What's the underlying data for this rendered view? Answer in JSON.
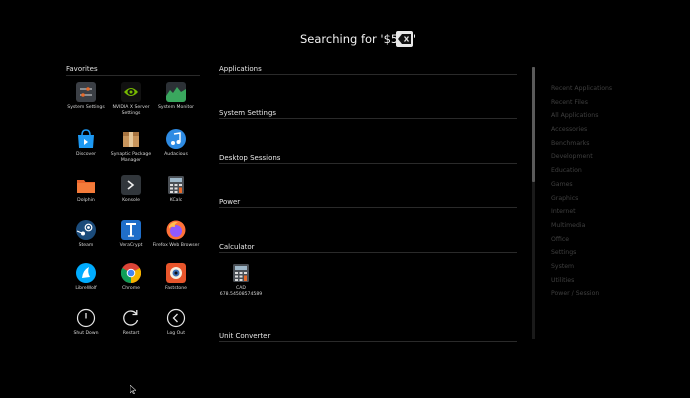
{
  "search": {
    "text": "Searching for '$500'",
    "clear_icon": "backspace-icon"
  },
  "favorites": {
    "header": "Favorites",
    "items": [
      {
        "label": "System Settings",
        "icon": "system-settings-icon"
      },
      {
        "label": "NVIDIA X Server Settings",
        "icon": "nvidia-icon"
      },
      {
        "label": "System Monitor",
        "icon": "system-monitor-icon"
      },
      {
        "label": "Discover",
        "icon": "discover-icon"
      },
      {
        "label": "Synaptic Package Manager",
        "icon": "synaptic-icon"
      },
      {
        "label": "Audacious",
        "icon": "audacious-icon"
      },
      {
        "label": "Dolphin",
        "icon": "dolphin-icon"
      },
      {
        "label": "Konsole",
        "icon": "konsole-icon"
      },
      {
        "label": "KCalc",
        "icon": "kcalc-icon"
      },
      {
        "label": "Steam",
        "icon": "steam-icon"
      },
      {
        "label": "VeraCrypt",
        "icon": "veracrypt-icon"
      },
      {
        "label": "Firefox Web Browser",
        "icon": "firefox-icon"
      },
      {
        "label": "LibreWolf",
        "icon": "librewolf-icon"
      },
      {
        "label": "Chrome",
        "icon": "chrome-icon"
      },
      {
        "label": "Faststone",
        "icon": "faststone-icon"
      },
      {
        "label": "Shut Down",
        "icon": "power-icon"
      },
      {
        "label": "Restart",
        "icon": "restart-icon"
      },
      {
        "label": "Log Out",
        "icon": "logout-icon"
      }
    ]
  },
  "results": {
    "sections": [
      {
        "title": "Applications"
      },
      {
        "title": "System Settings"
      },
      {
        "title": "Desktop Sessions"
      },
      {
        "title": "Power"
      },
      {
        "title": "Calculator"
      },
      {
        "title": "Unit Converter"
      }
    ],
    "calculator_result": {
      "name": "CAD",
      "value": "678.54508574589",
      "icon": "calculator-icon"
    }
  },
  "categories": [
    "Recent Applications",
    "Recent Files",
    "All Applications",
    "Accessories",
    "Benchmarks",
    "Development",
    "Education",
    "Games",
    "Graphics",
    "Internet",
    "Multimedia",
    "Office",
    "Settings",
    "System",
    "Utilities",
    "Power / Session"
  ],
  "colors": {
    "background": "#000000",
    "text": "#e6e6e6",
    "category_text": "#3f3f3f",
    "divider": "#2a2a2a"
  }
}
